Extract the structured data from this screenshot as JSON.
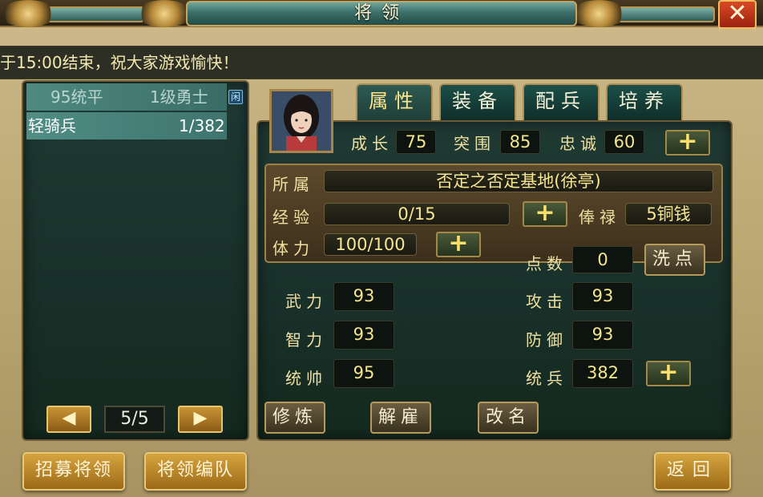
{
  "window": {
    "title": "将领",
    "close_label": "✕"
  },
  "ticker": {
    "text": "于15:00结束，祝大家游戏愉快！"
  },
  "unit_list": {
    "rows": [
      {
        "left": "95统平",
        "right": "1级勇士",
        "tag": "闲"
      },
      {
        "left": "轻骑兵",
        "right": "1/382"
      }
    ],
    "pager": {
      "prev_icon": "◀",
      "next_icon": "▶",
      "page": "5/5"
    }
  },
  "tabs": [
    {
      "label": "属性",
      "active": true
    },
    {
      "label": "装备",
      "active": false
    },
    {
      "label": "配兵",
      "active": false
    },
    {
      "label": "培养",
      "active": false
    }
  ],
  "growth": {
    "grow_label": "成长",
    "grow_value": "75",
    "break_label": "突围",
    "break_value": "85",
    "loyal_label": "忠诚",
    "loyal_value": "60",
    "plus": "+"
  },
  "info": {
    "belong_label": "所属",
    "belong_value": "否定之否定基地(徐亭)",
    "exp_label": "经验",
    "exp_value": "0/15",
    "salary_label": "俸禄",
    "salary_value": "5铜钱",
    "stamina_label": "体力",
    "stamina_value": "100/100",
    "plus": "+"
  },
  "points": {
    "label": "点数",
    "value": "0",
    "reset_label": "洗点"
  },
  "stats": {
    "wuli_label": "武力",
    "wuli_value": "93",
    "zhili_label": "智力",
    "zhili_value": "93",
    "tongshuai_label": "统帅",
    "tongshuai_value": "95",
    "gongji_label": "攻击",
    "gongji_value": "93",
    "fangyu_label": "防御",
    "fangyu_value": "93",
    "tongbing_label": "统兵",
    "tongbing_value": "382",
    "plus": "+"
  },
  "actions": {
    "train": "修炼",
    "dismiss": "解雇",
    "rename": "改名"
  },
  "bottom": {
    "recruit": "招募将领",
    "formation": "将领编队",
    "back": "返回"
  }
}
